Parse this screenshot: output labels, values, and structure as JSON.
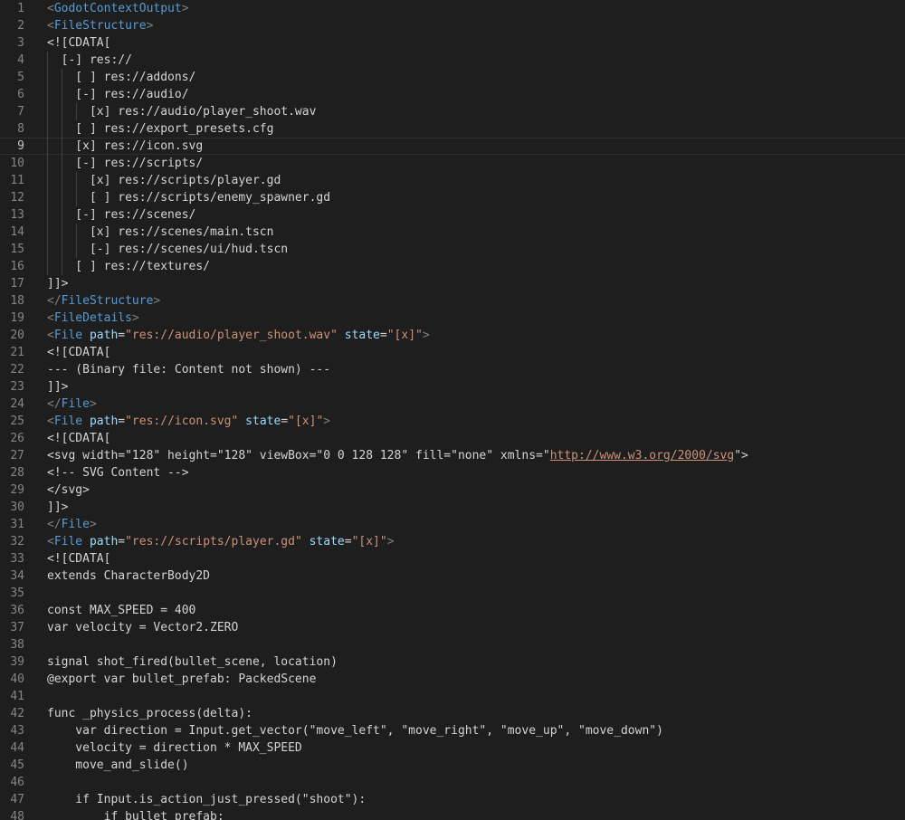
{
  "editor": {
    "current_line": 9,
    "lines": [
      {
        "n": "1",
        "indent": 0,
        "tokens": [
          [
            "b",
            "<"
          ],
          [
            "g",
            "GodotContextOutput"
          ],
          [
            "b",
            ">"
          ]
        ]
      },
      {
        "n": "2",
        "indent": 0,
        "tokens": [
          [
            "b",
            "<"
          ],
          [
            "g",
            "FileStructure"
          ],
          [
            "b",
            ">"
          ]
        ]
      },
      {
        "n": "3",
        "indent": 0,
        "tokens": [
          [
            "t",
            "<![CDATA["
          ]
        ]
      },
      {
        "n": "4",
        "indent": 1,
        "tokens": [
          [
            "t",
            "  [-] res://"
          ]
        ]
      },
      {
        "n": "5",
        "indent": 2,
        "tokens": [
          [
            "t",
            "    [ ] res://addons/"
          ]
        ]
      },
      {
        "n": "6",
        "indent": 2,
        "tokens": [
          [
            "t",
            "    [-] res://audio/"
          ]
        ]
      },
      {
        "n": "7",
        "indent": 3,
        "tokens": [
          [
            "t",
            "      [x] res://audio/player_shoot.wav"
          ]
        ]
      },
      {
        "n": "8",
        "indent": 2,
        "tokens": [
          [
            "t",
            "    [ ] res://export_presets.cfg"
          ]
        ]
      },
      {
        "n": "9",
        "indent": 2,
        "tokens": [
          [
            "t",
            "    [x] res://icon.svg"
          ]
        ]
      },
      {
        "n": "10",
        "indent": 2,
        "tokens": [
          [
            "t",
            "    [-] res://scripts/"
          ]
        ]
      },
      {
        "n": "11",
        "indent": 3,
        "tokens": [
          [
            "t",
            "      [x] res://scripts/player.gd"
          ]
        ]
      },
      {
        "n": "12",
        "indent": 3,
        "tokens": [
          [
            "t",
            "      [ ] res://scripts/enemy_spawner.gd"
          ]
        ]
      },
      {
        "n": "13",
        "indent": 2,
        "tokens": [
          [
            "t",
            "    [-] res://scenes/"
          ]
        ]
      },
      {
        "n": "14",
        "indent": 3,
        "tokens": [
          [
            "t",
            "      [x] res://scenes/main.tscn"
          ]
        ]
      },
      {
        "n": "15",
        "indent": 3,
        "tokens": [
          [
            "t",
            "      [-] res://scenes/ui/hud.tscn"
          ]
        ]
      },
      {
        "n": "16",
        "indent": 2,
        "tokens": [
          [
            "t",
            "    [ ] res://textures/"
          ]
        ]
      },
      {
        "n": "17",
        "indent": 0,
        "tokens": [
          [
            "t",
            "]]>"
          ]
        ]
      },
      {
        "n": "18",
        "indent": 0,
        "tokens": [
          [
            "b",
            "</"
          ],
          [
            "g",
            "FileStructure"
          ],
          [
            "b",
            ">"
          ]
        ]
      },
      {
        "n": "19",
        "indent": 0,
        "tokens": [
          [
            "b",
            "<"
          ],
          [
            "g",
            "FileDetails"
          ],
          [
            "b",
            ">"
          ]
        ]
      },
      {
        "n": "20",
        "indent": 0,
        "tokens": [
          [
            "b",
            "<"
          ],
          [
            "g",
            "File"
          ],
          [
            "t",
            " "
          ],
          [
            "a",
            "path"
          ],
          [
            "t",
            "="
          ],
          [
            "s",
            "\"res://audio/player_shoot.wav\""
          ],
          [
            "t",
            " "
          ],
          [
            "a",
            "state"
          ],
          [
            "t",
            "="
          ],
          [
            "s",
            "\"[x]\""
          ],
          [
            "b",
            ">"
          ]
        ]
      },
      {
        "n": "21",
        "indent": 0,
        "tokens": [
          [
            "t",
            "<![CDATA["
          ]
        ]
      },
      {
        "n": "22",
        "indent": 0,
        "tokens": [
          [
            "t",
            "--- (Binary file: Content not shown) ---"
          ]
        ]
      },
      {
        "n": "23",
        "indent": 0,
        "tokens": [
          [
            "t",
            "]]>"
          ]
        ]
      },
      {
        "n": "24",
        "indent": 0,
        "tokens": [
          [
            "b",
            "</"
          ],
          [
            "g",
            "File"
          ],
          [
            "b",
            ">"
          ]
        ]
      },
      {
        "n": "25",
        "indent": 0,
        "tokens": [
          [
            "b",
            "<"
          ],
          [
            "g",
            "File"
          ],
          [
            "t",
            " "
          ],
          [
            "a",
            "path"
          ],
          [
            "t",
            "="
          ],
          [
            "s",
            "\"res://icon.svg\""
          ],
          [
            "t",
            " "
          ],
          [
            "a",
            "state"
          ],
          [
            "t",
            "="
          ],
          [
            "s",
            "\"[x]\""
          ],
          [
            "b",
            ">"
          ]
        ]
      },
      {
        "n": "26",
        "indent": 0,
        "tokens": [
          [
            "t",
            "<![CDATA["
          ]
        ]
      },
      {
        "n": "27",
        "indent": 0,
        "tokens": [
          [
            "t",
            "<svg width=\"128\" height=\"128\" viewBox=\"0 0 128 128\" fill=\"none\" xmlns=\""
          ],
          [
            "l",
            "http://www.w3.org/2000/svg"
          ],
          [
            "t",
            "\">"
          ]
        ]
      },
      {
        "n": "28",
        "indent": 0,
        "tokens": [
          [
            "t",
            "<!-- SVG Content -->"
          ]
        ]
      },
      {
        "n": "29",
        "indent": 0,
        "tokens": [
          [
            "t",
            "</svg>"
          ]
        ]
      },
      {
        "n": "30",
        "indent": 0,
        "tokens": [
          [
            "t",
            "]]>"
          ]
        ]
      },
      {
        "n": "31",
        "indent": 0,
        "tokens": [
          [
            "b",
            "</"
          ],
          [
            "g",
            "File"
          ],
          [
            "b",
            ">"
          ]
        ]
      },
      {
        "n": "32",
        "indent": 0,
        "tokens": [
          [
            "b",
            "<"
          ],
          [
            "g",
            "File"
          ],
          [
            "t",
            " "
          ],
          [
            "a",
            "path"
          ],
          [
            "t",
            "="
          ],
          [
            "s",
            "\"res://scripts/player.gd\""
          ],
          [
            "t",
            " "
          ],
          [
            "a",
            "state"
          ],
          [
            "t",
            "="
          ],
          [
            "s",
            "\"[x]\""
          ],
          [
            "b",
            ">"
          ]
        ]
      },
      {
        "n": "33",
        "indent": 0,
        "tokens": [
          [
            "t",
            "<![CDATA["
          ]
        ]
      },
      {
        "n": "34",
        "indent": 0,
        "tokens": [
          [
            "t",
            "extends CharacterBody2D"
          ]
        ]
      },
      {
        "n": "35",
        "indent": 0,
        "tokens": []
      },
      {
        "n": "36",
        "indent": 0,
        "tokens": [
          [
            "t",
            "const MAX_SPEED = 400"
          ]
        ]
      },
      {
        "n": "37",
        "indent": 0,
        "tokens": [
          [
            "t",
            "var velocity = Vector2.ZERO"
          ]
        ]
      },
      {
        "n": "38",
        "indent": 0,
        "tokens": []
      },
      {
        "n": "39",
        "indent": 0,
        "tokens": [
          [
            "t",
            "signal shot_fired(bullet_scene, location)"
          ]
        ]
      },
      {
        "n": "40",
        "indent": 0,
        "tokens": [
          [
            "t",
            "@export var bullet_prefab: PackedScene"
          ]
        ]
      },
      {
        "n": "41",
        "indent": 0,
        "tokens": []
      },
      {
        "n": "42",
        "indent": 0,
        "tokens": [
          [
            "t",
            "func _physics_process(delta):"
          ]
        ]
      },
      {
        "n": "43",
        "indent": 0,
        "tokens": [
          [
            "t",
            "    var direction = Input.get_vector(\"move_left\", \"move_right\", \"move_up\", \"move_down\")"
          ]
        ]
      },
      {
        "n": "44",
        "indent": 0,
        "tokens": [
          [
            "t",
            "    velocity = direction * MAX_SPEED"
          ]
        ]
      },
      {
        "n": "45",
        "indent": 0,
        "tokens": [
          [
            "t",
            "    move_and_slide()"
          ]
        ]
      },
      {
        "n": "46",
        "indent": 0,
        "tokens": []
      },
      {
        "n": "47",
        "indent": 0,
        "tokens": [
          [
            "t",
            "    if Input.is_action_just_pressed(\"shoot\"):"
          ]
        ]
      },
      {
        "n": "48",
        "indent": 0,
        "tokens": [
          [
            "t",
            "        if bullet_prefab:"
          ]
        ]
      }
    ]
  },
  "colors": {
    "background": "#1e1e1e",
    "line_number": "#858585",
    "line_number_active": "#c6c6c6",
    "tag": "#569cd6",
    "bracket": "#808080",
    "attribute": "#9cdcfe",
    "string": "#ce9178",
    "text": "#d4d4d4",
    "indent_guide": "#404040"
  }
}
